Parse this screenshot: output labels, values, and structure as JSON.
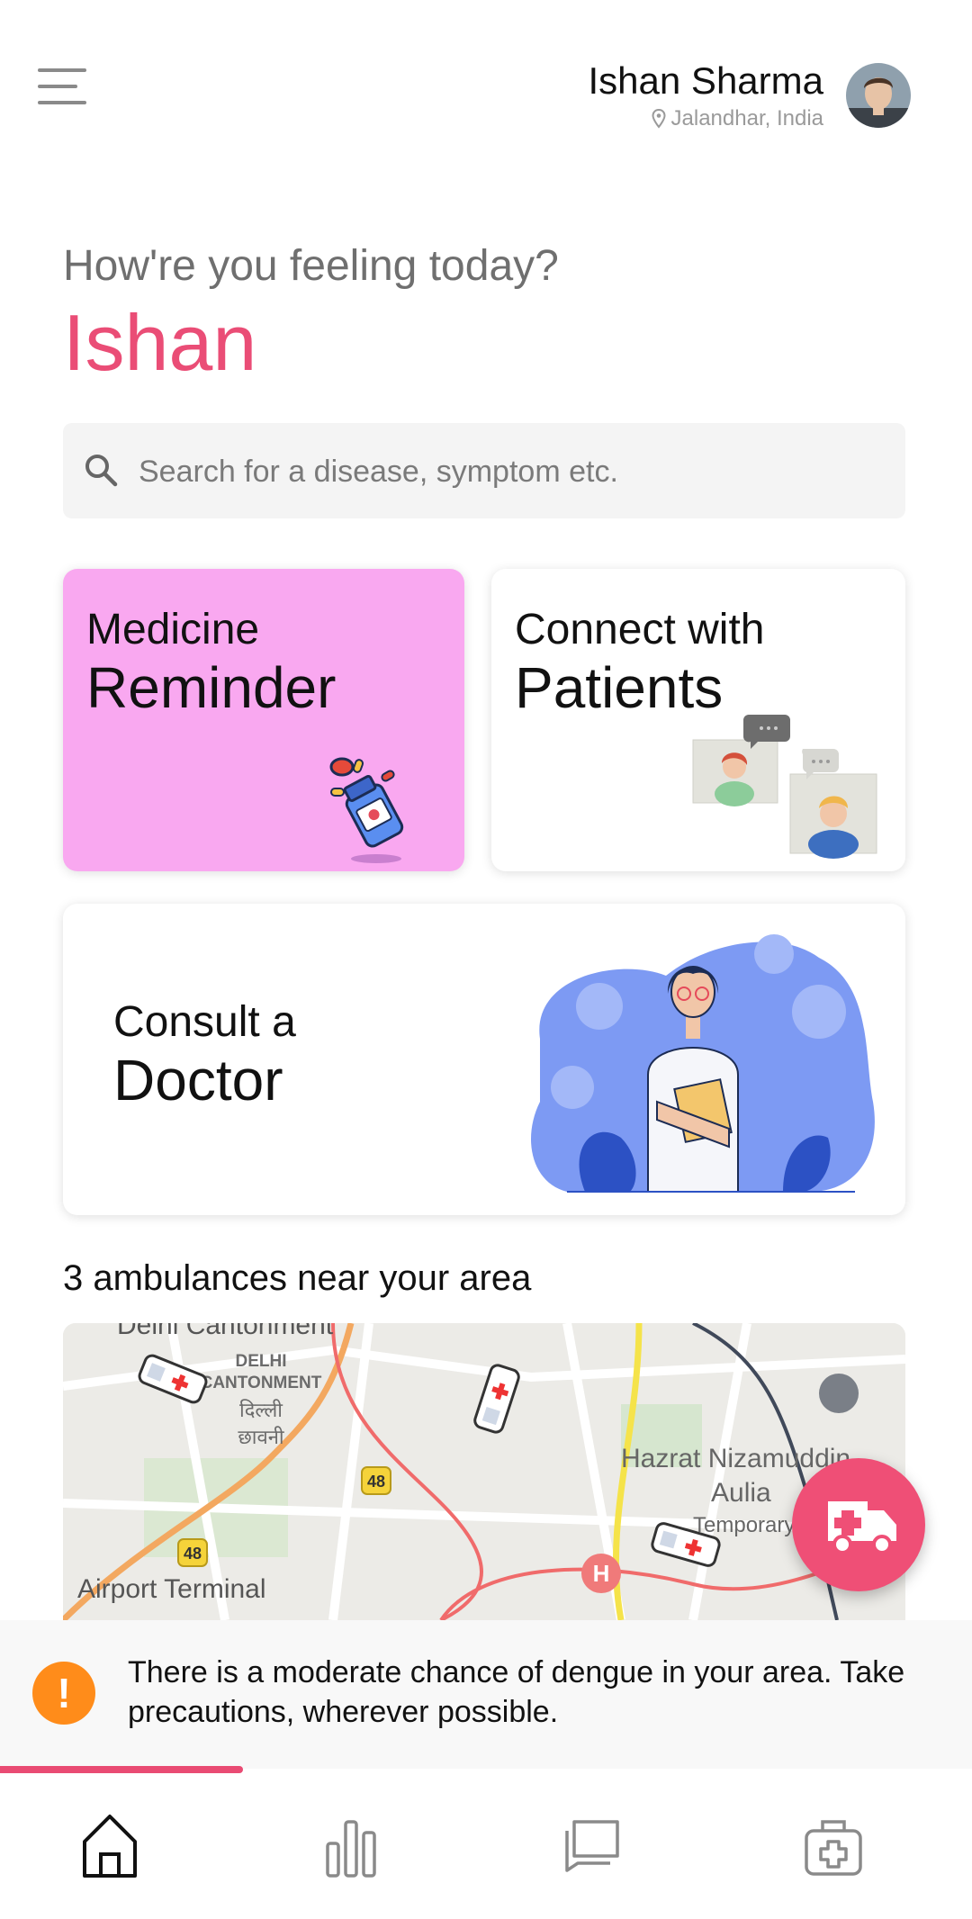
{
  "header": {
    "user_name": "Ishan Sharma",
    "location": "Jalandhar, India"
  },
  "hero": {
    "greeting": "How're you feeling today?",
    "name": "Ishan"
  },
  "search": {
    "placeholder": "Search for a disease, symptom etc."
  },
  "cards": {
    "medicine": {
      "line1": "Medicine",
      "line2": "Reminder",
      "bg": "#f9a8f0"
    },
    "connect": {
      "line1": "Connect with",
      "line2": "Patients"
    },
    "consult": {
      "line1": "Consult a",
      "line2": "Doctor"
    }
  },
  "ambulances": {
    "title": "3 ambulances near your area",
    "map_labels": {
      "delhi_cantonment_top": "Delhi Cantonment",
      "delhi": "DELHI",
      "cantonment": "CANTONMENT",
      "hindi1": "दिल्ली",
      "hindi2": "छावनी",
      "hazrat": "Hazrat Nizamuddin",
      "aulia": "Aulia",
      "temporary": "Temporary",
      "airport": "Airport Terminal",
      "road48a": "48",
      "road48b": "48"
    }
  },
  "alert": {
    "text": "There is a moderate chance of dengue in your area.  Take precautions, wherever possible.",
    "icon_symbol": "!",
    "progress": 0.25
  },
  "bottom_nav": {
    "items": [
      "home-icon",
      "stats-icon",
      "chat-icon",
      "medical-kit-icon"
    ]
  },
  "colors": {
    "accent": "#ea4d76",
    "alert": "#ff8c1a",
    "doctor_blue": "#6c8ef2"
  }
}
